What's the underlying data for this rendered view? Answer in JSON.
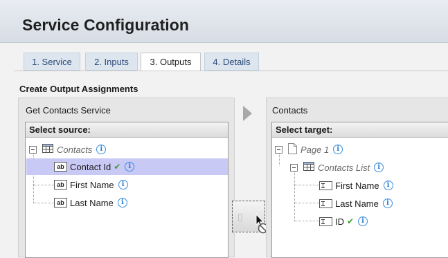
{
  "header": {
    "title": "Service Configuration"
  },
  "tabs": [
    {
      "label": "1. Service",
      "active": false
    },
    {
      "label": "2. Inputs",
      "active": false
    },
    {
      "label": "3. Outputs",
      "active": true
    },
    {
      "label": "4. Details",
      "active": false
    }
  ],
  "section": {
    "title": "Create Output Assignments"
  },
  "source": {
    "panel_title": "Get Contacts Service",
    "list_header": "Select source:",
    "root": {
      "label": "Contacts",
      "icon": "table-icon"
    },
    "items": [
      {
        "label": "Contact Id",
        "icon": "text-field-icon",
        "mapped": true,
        "selected": true
      },
      {
        "label": "First Name",
        "icon": "text-field-icon",
        "mapped": false,
        "selected": false
      },
      {
        "label": "Last Name",
        "icon": "text-field-icon",
        "mapped": false,
        "selected": false
      }
    ]
  },
  "target": {
    "panel_title": "Contacts",
    "list_header": "Select target:",
    "root": {
      "label": "Page 1",
      "icon": "page-icon"
    },
    "list": {
      "label": "Contacts List",
      "icon": "table-icon"
    },
    "items": [
      {
        "label": "First Name",
        "icon": "input-field-icon",
        "mapped": false
      },
      {
        "label": "Last Name",
        "icon": "input-field-icon",
        "mapped": false
      },
      {
        "label": "ID",
        "icon": "input-field-icon",
        "mapped": true
      }
    ]
  },
  "colors": {
    "selected_row": "#c9c9f6",
    "tab_inactive": "#dde6ef",
    "tab_text": "#2a4a78",
    "info_blue": "#3a8de0",
    "check_green": "#3c9b2f"
  },
  "icons": {
    "info": "ⓘ",
    "check": "✔",
    "text_field": "ab"
  }
}
